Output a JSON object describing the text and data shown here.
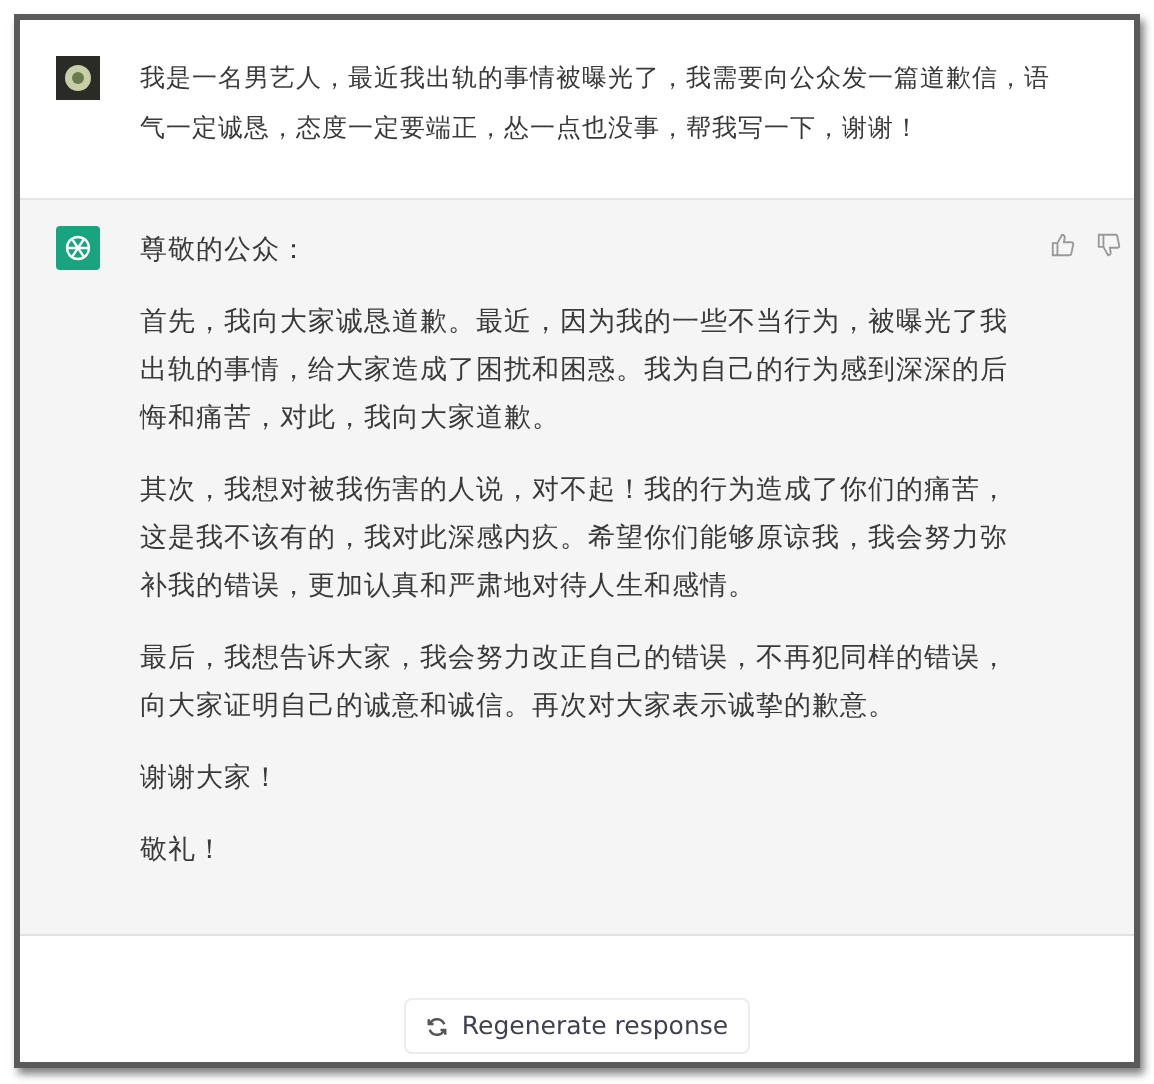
{
  "conversation": [
    {
      "kind": "user",
      "text": "我是一名男艺人，最近我出轨的事情被曝光了，我需要向公众发一篇道歉信，语气一定诚恳，态度一定要端正，怂一点也没事，帮我写一下，谢谢！"
    },
    {
      "kind": "assistant",
      "paragraphs": [
        "尊敬的公众：",
        "首先，我向大家诚恳道歉。最近，因为我的一些不当行为，被曝光了我出轨的事情，给大家造成了困扰和困惑。我为自己的行为感到深深的后悔和痛苦，对此，我向大家道歉。",
        "其次，我想对被我伤害的人说，对不起！我的行为造成了你们的痛苦，这是我不该有的，我对此深感内疚。希望你们能够原谅我，我会努力弥补我的错误，更加认真和严肃地对待人生和感情。",
        "最后，我想告诉大家，我会努力改正自己的错误，不再犯同样的错误，向大家证明自己的诚意和诚信。再次对大家表示诚挚的歉意。",
        "谢谢大家！",
        "敬礼！"
      ]
    }
  ],
  "regenerate_button": "Regenerate response"
}
